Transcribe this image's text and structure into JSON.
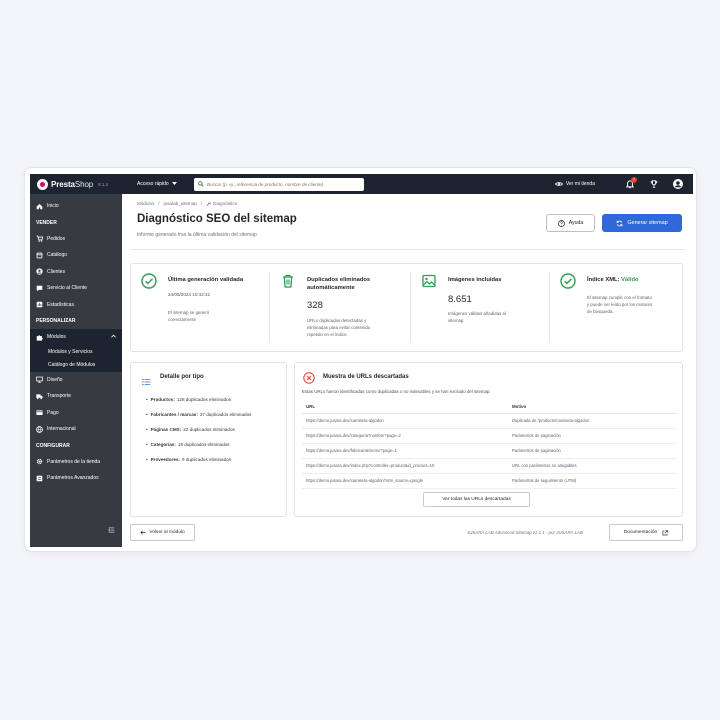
{
  "topbar": {
    "logo_presta": "Presta",
    "logo_shop": "Shop",
    "version": "8.1.4",
    "quick_access": "Acceso rápido",
    "search_placeholder": "Buscar (p. ej.: referencia de producto, nombre de cliente)",
    "view_shop": "Ver mi tienda",
    "notifications_count": "7"
  },
  "sidebar": {
    "inicio": "Inicio",
    "section_vender": "VENDER",
    "pedidos": "Pedidos",
    "catalogo": "Catálogo",
    "clientes": "Clientes",
    "servicio": "Servicio al Cliente",
    "estadisticas": "Estadísticas",
    "section_personalizar": "PERSONALIZAR",
    "modulos": "Módulos",
    "modulos_servicios": "Módulos y Servicios",
    "catalogo_modulos": "Catálogo de Módulos",
    "diseno": "Diseño",
    "transporte": "Transporte",
    "pago": "Pago",
    "internacional": "Internacional",
    "section_configurar": "CONFIGURAR",
    "parametros_tienda": "Parámetros de la tienda",
    "parametros_avanzados": "Parámetros Avanzados"
  },
  "breadcrumb": {
    "b1": "Módulos",
    "sep": "/",
    "b2": "jusalab_sitemap",
    "b3": "Diagnóstico"
  },
  "header": {
    "title": "Diagnóstico SEO del sitemap",
    "subtitle": "Informe generado tras la última validación del sitemap",
    "help_label": "Ayuda",
    "generate_label": "Generar sitemap"
  },
  "stats": {
    "s1": {
      "title": "Última generación validada",
      "date": "24/05/2024 10:42:31",
      "desc1": "El sitemap se generó",
      "desc2": "correctamente"
    },
    "s2": {
      "title1": "Duplicados eliminados",
      "title2": "automáticamente",
      "value": "328",
      "desc1": "URLs duplicadas detectadas y",
      "desc2": "eliminadas para evitar contenido",
      "desc3": "repetido en el índice."
    },
    "s3": {
      "title": "Imágenes incluidas",
      "value": "8.651",
      "desc1": "Imágenes válidas añadidas al",
      "desc2": "sitemap."
    },
    "s4": {
      "title": "Índice XML:",
      "status": "Válido",
      "desc1": "El sitemap cumple con el formato",
      "desc2": "y puede ser leído por los motores",
      "desc3": "de búsqueda."
    }
  },
  "detail": {
    "title": "Detalle por tipo",
    "items": [
      {
        "label": "Productos:",
        "value": "128 duplicados eliminados"
      },
      {
        "label": "Fabricantes / marcas:",
        "value": "37 duplicados eliminados"
      },
      {
        "label": "Páginas CMS:",
        "value": "22 duplicados eliminados"
      },
      {
        "label": "Categorías:",
        "value": "18 duplicados eliminados"
      },
      {
        "label": "Proveedores:",
        "value": "9 duplicados eliminados"
      }
    ]
  },
  "urls": {
    "title": "Muestra de URLs descartadas",
    "desc": "Estas URLs fueron identificadas como duplicadas o no indexables y se han excluido del sitemap.",
    "col_url": "URL",
    "col_reason": "Motivo",
    "rows": [
      {
        "url": "https://demo.jusara.dev/camiseta-algodon",
        "reason": "Duplicada de /producto/camiseta-algodon"
      },
      {
        "url": "https://demo.jusara.dev/categoria?nombre?page=2",
        "reason": "Parámetros de paginación"
      },
      {
        "url": "https://demo.jusara.dev/fabricante/acme?page=1",
        "reason": "Parámetros de paginación"
      },
      {
        "url": "https://demo.jusara.dev/index.php?controller=product&id_product=10",
        "reason": "URL con parámetros no amigables"
      },
      {
        "url": "https://demo.jusara.dev/camiseta-algodon?utm_source=google",
        "reason": "Parámetros de seguimiento (UTM)"
      }
    ],
    "view_all": "Ver todas las URLs descartadas"
  },
  "footer": {
    "back": "Volver al módulo",
    "credit": "JUSARA LAB Advanced Sitemap v2.1.1 - por JUSARA LAB",
    "docs": "Documentación"
  },
  "colors": {
    "primary": "#2f68d8",
    "sidebar": "#363a41",
    "topbar": "#1d2430",
    "success": "#2e9e52",
    "danger": "#e53935"
  }
}
